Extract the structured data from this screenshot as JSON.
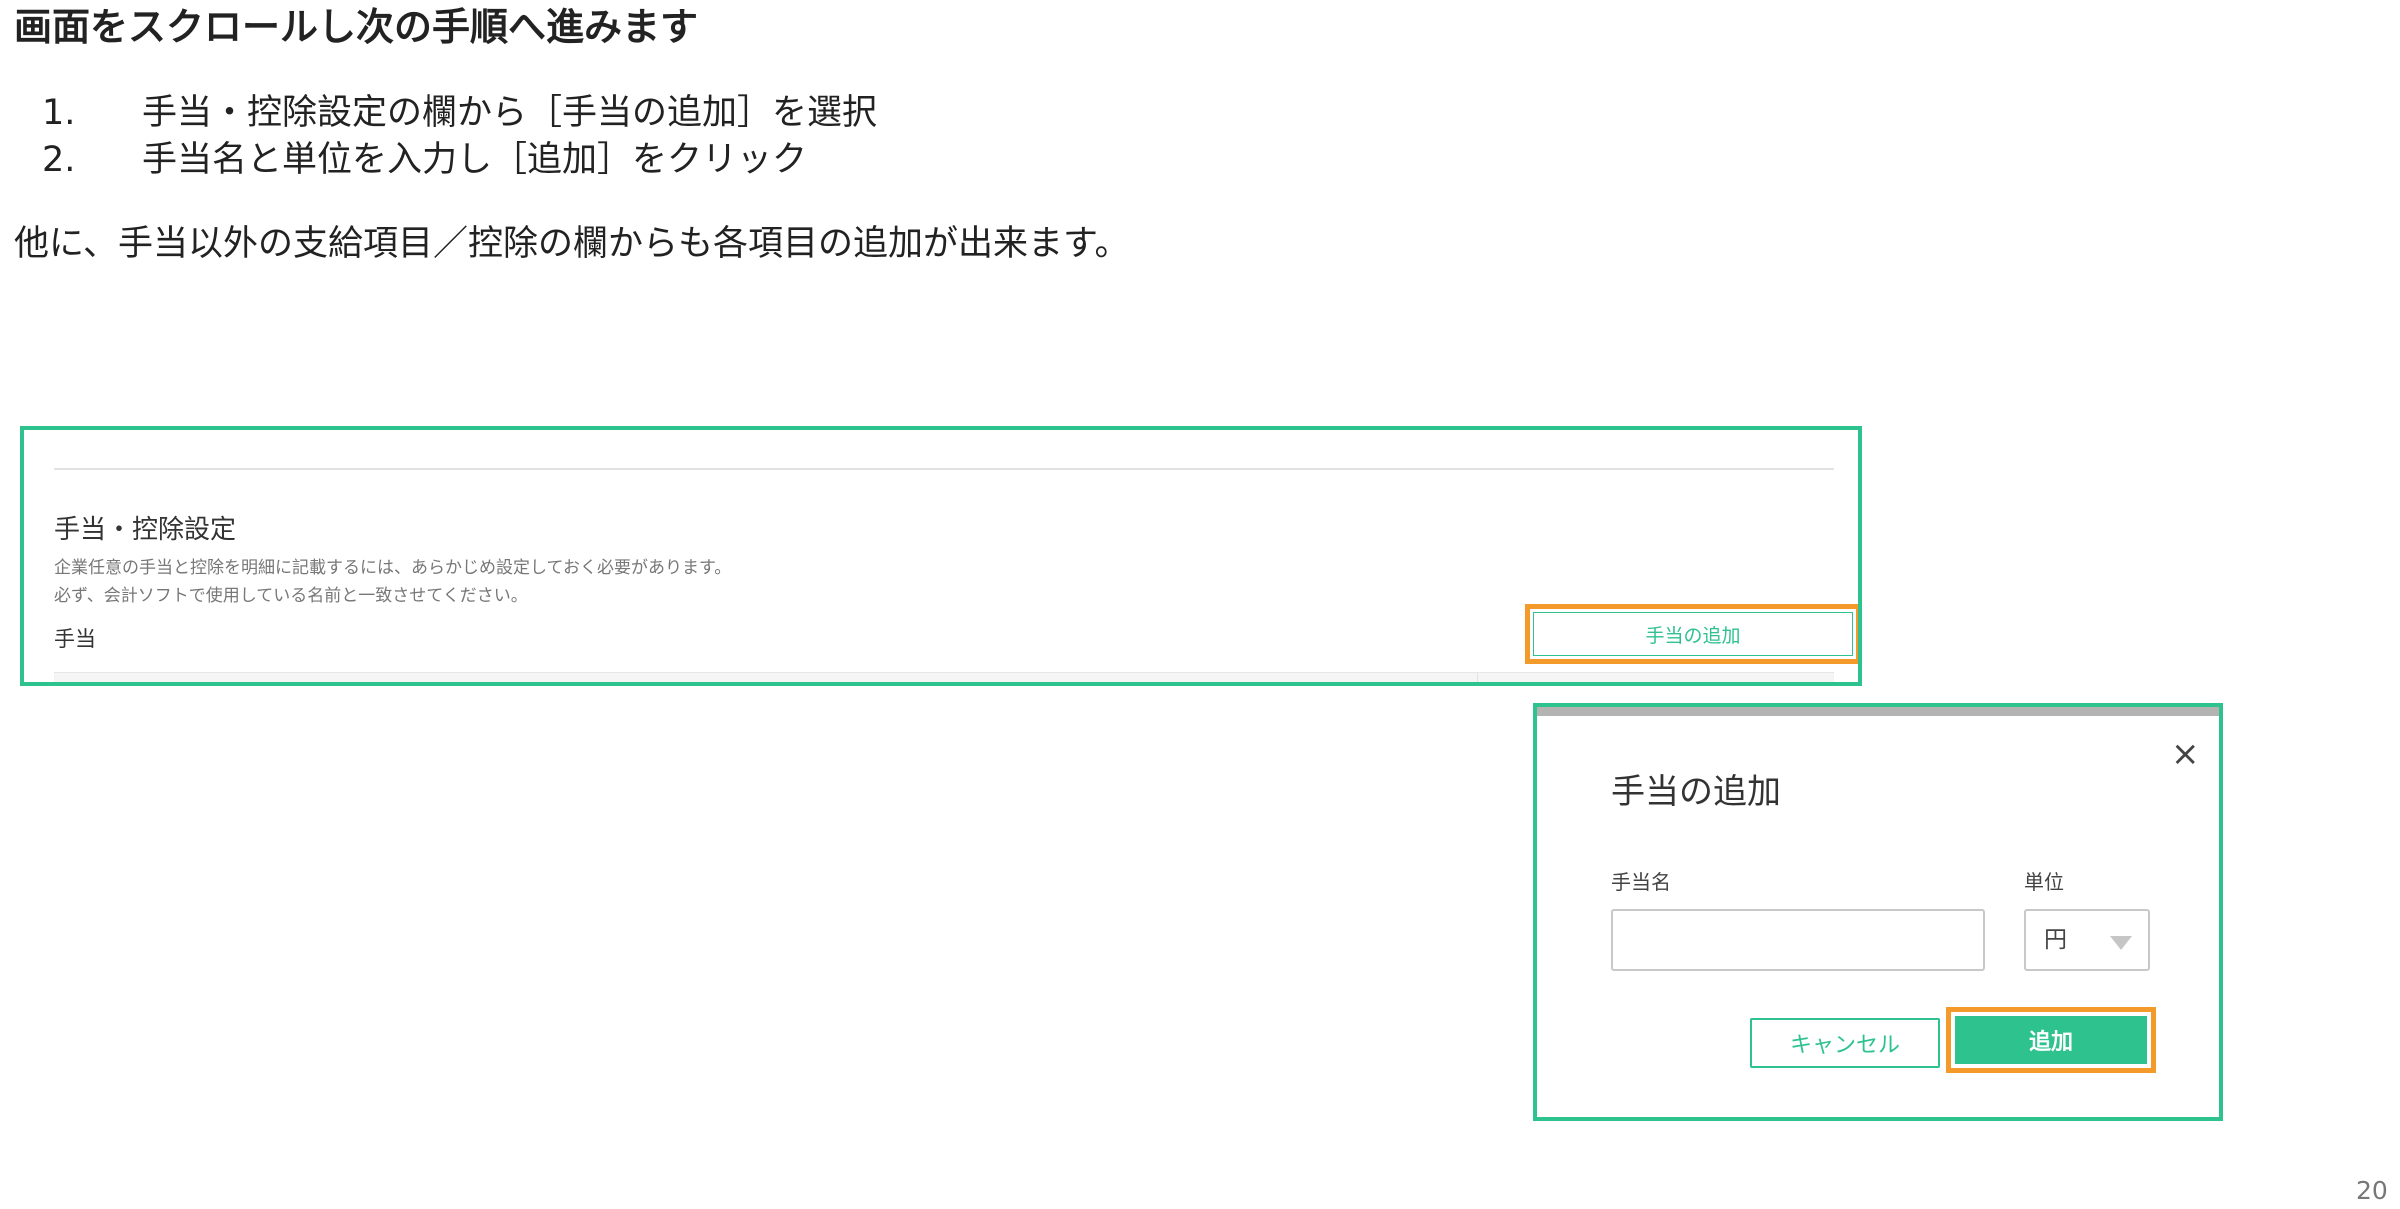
{
  "slide": {
    "title": "画面をスクロールし次の手順へ進みます",
    "steps": [
      {
        "num": "1.",
        "text": "手当・控除設定の欄から［手当の追加］を選択"
      },
      {
        "num": "2.",
        "text": "手当名と単位を入力し［追加］をクリック"
      }
    ],
    "note": "他に、手当以外の支給項目／控除の欄からも各項目の追加が出来ます。",
    "page_number": "20"
  },
  "settings_panel": {
    "title": "手当・控除設定",
    "description_lines": [
      "企業任意の手当と控除を明細に記載するには、あらかじめ設定しておく必要があります。",
      "必ず、会計ソフトで使用している名前と一致させてください。"
    ],
    "section_label": "手当",
    "add_button_label": "手当の追加"
  },
  "dialog": {
    "title": "手当の追加",
    "close_symbol": "×",
    "name_label": "手当名",
    "name_value": "",
    "unit_label": "単位",
    "unit_value": "円",
    "cancel_label": "キャンセル",
    "add_label": "追加"
  },
  "colors": {
    "accent_green": "#2ec28f",
    "highlight_orange": "#f39a2b"
  }
}
